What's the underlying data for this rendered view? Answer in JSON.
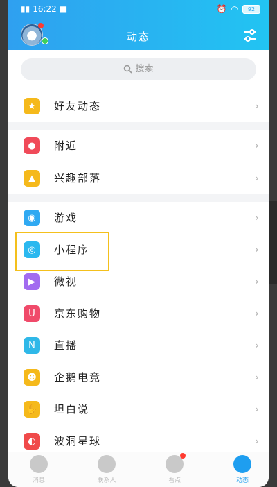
{
  "status": {
    "time": "16:22",
    "battery": "92"
  },
  "header": {
    "title": "动态"
  },
  "search": {
    "placeholder": "搜索"
  },
  "groups": [
    {
      "items": [
        {
          "label": "好友动态",
          "icon": "star-icon",
          "color": "#f5b91b"
        }
      ]
    },
    {
      "items": [
        {
          "label": "附近",
          "icon": "location-pin-icon",
          "color": "#f04a59"
        },
        {
          "label": "兴趣部落",
          "icon": "triangle-tribe-icon",
          "color": "#f5b91b"
        }
      ]
    },
    {
      "items": [
        {
          "label": "游戏",
          "icon": "gamepad-icon",
          "color": "#2fa9f2"
        },
        {
          "label": "小程序",
          "icon": "mini-program-icon",
          "color": "#2bb8ef"
        },
        {
          "label": "微视",
          "icon": "play-icon",
          "color": "#a26bf0"
        },
        {
          "label": "京东购物",
          "icon": "shopping-bag-icon",
          "color": "#f04a6a"
        },
        {
          "label": "直播",
          "icon": "live-icon",
          "color": "#2fb8e8"
        },
        {
          "label": "企鹅电竞",
          "icon": "esports-icon",
          "color": "#f5b91b"
        },
        {
          "label": "坦白说",
          "icon": "hand-icon",
          "color": "#f5b91b"
        },
        {
          "label": "波洞星球",
          "icon": "planet-icon",
          "color": "#f04a4a"
        }
      ]
    }
  ],
  "tabbar": [
    {
      "label": "消息",
      "icon": "chat-icon",
      "active": false
    },
    {
      "label": "联系人",
      "icon": "contacts-icon",
      "active": false
    },
    {
      "label": "看点",
      "icon": "eye-icon",
      "active": false
    },
    {
      "label": "动态",
      "icon": "planet-icon",
      "active": true
    }
  ],
  "colors": {
    "header_start": "#2fa0f0",
    "header_end": "#22c4f2",
    "highlight_box": "#f4c01d",
    "active_tab": "#1e9ef0"
  }
}
